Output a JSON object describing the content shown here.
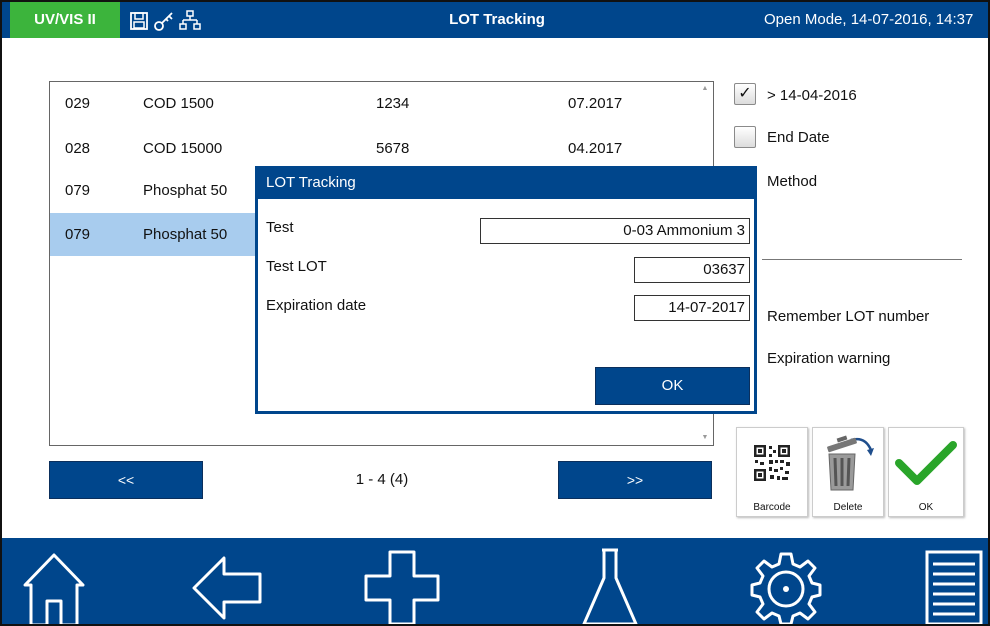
{
  "header": {
    "app_name": "UV/VIS II",
    "title": "LOT Tracking",
    "status": "Open Mode, 14-07-2016, 14:37",
    "icons": [
      "save-icon",
      "key-icon",
      "network-icon"
    ]
  },
  "table": {
    "rows": [
      {
        "num": "029",
        "name": "COD 1500",
        "lot": "1234",
        "date": "07.2017"
      },
      {
        "num": "028",
        "name": "COD 15000",
        "lot": "5678",
        "date": "04.2017"
      },
      {
        "num": "079",
        "name": "Phosphat 50",
        "lot": "",
        "date": ""
      },
      {
        "num": "079",
        "name": "Phosphat 50",
        "lot": "",
        "date": ""
      }
    ],
    "selected_row": 3
  },
  "pagination": {
    "prev_label": "<<",
    "info": "1 - 4 (4)",
    "next_label": ">>"
  },
  "filters": {
    "date_after": {
      "label": "> 14-04-2016",
      "checked": true
    },
    "end_date": {
      "label": "End Date",
      "checked": false
    },
    "method": {
      "label": "Method"
    }
  },
  "options": {
    "remember_lot": "Remember LOT number",
    "expiration_warning": "Expiration warning"
  },
  "actions": {
    "barcode": "Barcode",
    "delete": "Delete",
    "ok": "OK"
  },
  "dialog": {
    "title": "LOT Tracking",
    "test_label": "Test",
    "test_value": "0-03 Ammonium 3",
    "lot_label": "Test LOT",
    "lot_value": "03637",
    "expiry_label": "Expiration date",
    "expiry_value": "14-07-2017",
    "ok_label": "OK"
  },
  "nav": {
    "items": [
      "home-icon",
      "back-arrow-icon",
      "plus-icon",
      "flask-icon",
      "settings-gear-icon",
      "menu-list-icon"
    ]
  },
  "colors": {
    "primary": "#00468c",
    "app_badge": "#3cb43c",
    "selected_row": "#a8ccee",
    "check_green": "#2aa52a"
  }
}
